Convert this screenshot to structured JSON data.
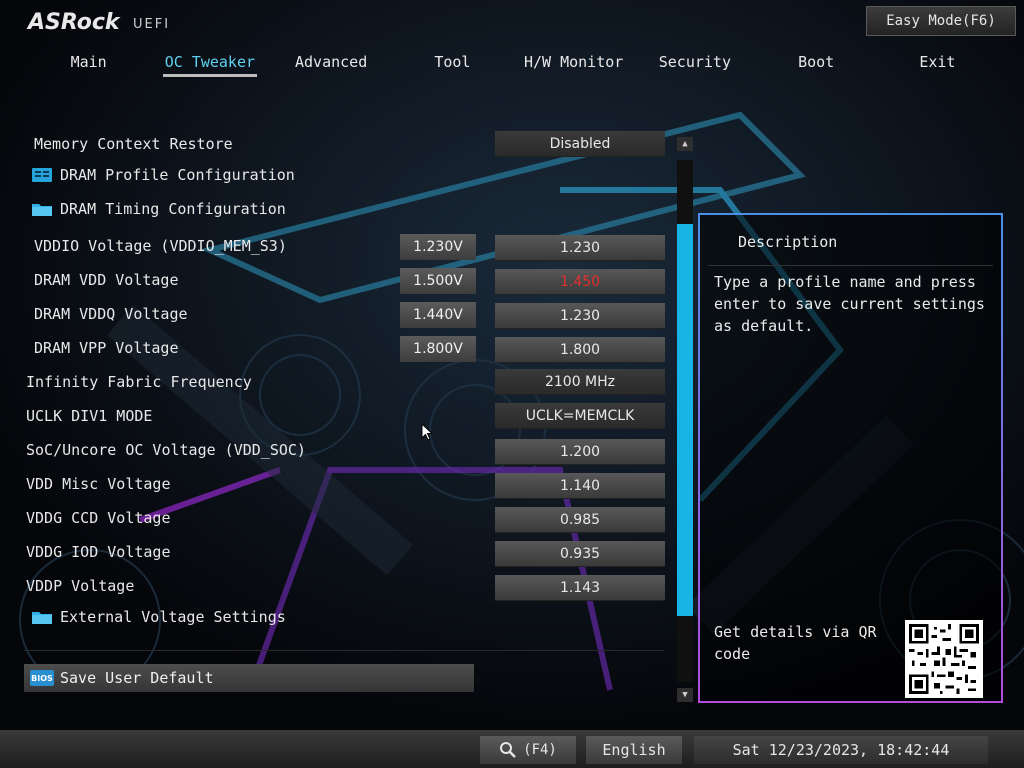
{
  "brand": {
    "name": "ASRock",
    "suffix": "UEFI"
  },
  "easy_mode_label": "Easy Mode(F6)",
  "tabs": [
    "Main",
    "OC Tweaker",
    "Advanced",
    "Tool",
    "H/W Monitor",
    "Security",
    "Boot",
    "Exit"
  ],
  "active_tab": "OC Tweaker",
  "settings": {
    "memory_context_restore": {
      "label": "Memory Context Restore",
      "value": "Disabled"
    },
    "dram_profile_config": {
      "label": "DRAM Profile Configuration"
    },
    "dram_timing_config": {
      "label": "DRAM Timing Configuration"
    },
    "vddio": {
      "label": "VDDIO Voltage (VDDIO_MEM_S3)",
      "current": "1.230V",
      "value": "1.230"
    },
    "dram_vdd": {
      "label": "DRAM VDD Voltage",
      "current": "1.500V",
      "value": "1.450"
    },
    "dram_vddq": {
      "label": "DRAM VDDQ Voltage",
      "current": "1.440V",
      "value": "1.230"
    },
    "dram_vpp": {
      "label": "DRAM VPP Voltage",
      "current": "1.800V",
      "value": "1.800"
    },
    "infinity_fabric": {
      "label": "Infinity Fabric Frequency",
      "value": "2100 MHz"
    },
    "uclk_div1": {
      "label": "UCLK DIV1 MODE",
      "value": "UCLK=MEMCLK"
    },
    "soc_voltage": {
      "label": "SoC/Uncore OC Voltage (VDD_SOC)",
      "value": "1.200"
    },
    "vdd_misc": {
      "label": "VDD Misc Voltage",
      "value": "1.140"
    },
    "vddg_ccd": {
      "label": "VDDG CCD Voltage",
      "value": "0.985"
    },
    "vddg_iod": {
      "label": "VDDG IOD Voltage",
      "value": "0.935"
    },
    "vddp": {
      "label": "VDDP Voltage",
      "value": "1.143"
    },
    "external_voltage": {
      "label": "External Voltage Settings"
    },
    "save_user_default": {
      "label": "Save User Default",
      "icon_text": "BIOS"
    }
  },
  "description": {
    "title": "Description",
    "text": "Type a profile name and press enter to save current settings as default.",
    "qr_text": "Get details via QR code"
  },
  "bottom": {
    "search_key": "(F4)",
    "language": "English",
    "datetime": "Sat 12/23/2023, 18:42:44"
  },
  "colors": {
    "accent": "#19b4e6",
    "active_tab": "#5fd0f0",
    "warning_value": "#e33030"
  }
}
